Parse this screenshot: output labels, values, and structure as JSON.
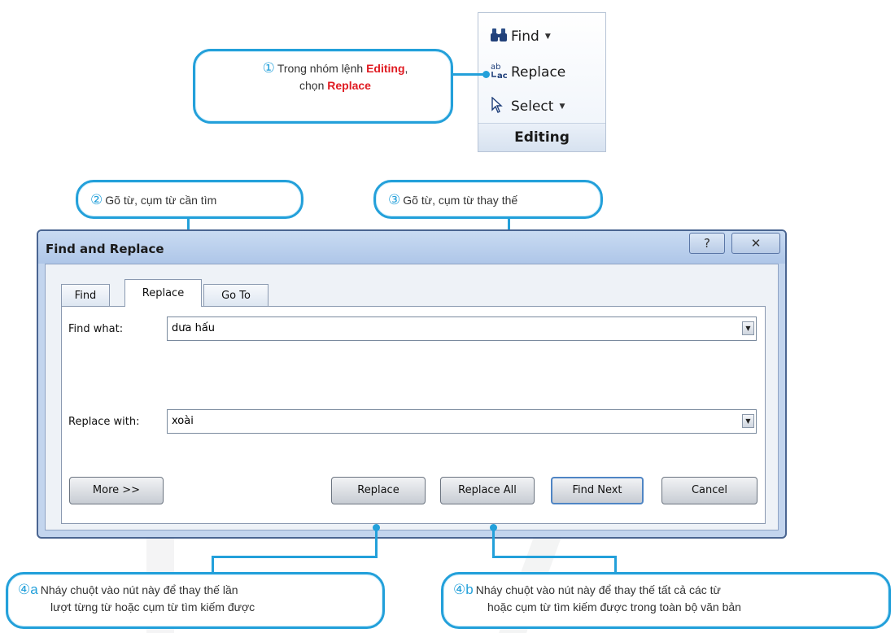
{
  "ribbon": {
    "find": "Find",
    "replace": "Replace",
    "select": "Select",
    "group": "Editing"
  },
  "callouts": {
    "c1": {
      "num": "①",
      "text_a": "Trong nhóm lệnh ",
      "text_b": "Editing",
      "text_c": ",",
      "text_d": "chọn ",
      "text_e": "Replace"
    },
    "c2": {
      "num": "②",
      "text": "Gõ từ, cụm từ cần tìm"
    },
    "c3": {
      "num": "③",
      "text": "Gõ từ, cụm từ thay thế"
    },
    "c4a": {
      "num": "④a",
      "line1": "Nháy chuột vào nút này để thay thế lần",
      "line2": "lượt từng từ hoặc cụm từ tìm kiếm được"
    },
    "c4b": {
      "num": "④b",
      "line1": "Nháy chuột vào nút này để thay thế tất cả các từ",
      "line2": "hoặc cụm từ tìm kiếm được trong toàn bộ văn bản"
    }
  },
  "dialog": {
    "title": "Find and Replace",
    "help": "?",
    "close": "✕",
    "tabs": [
      "Find",
      "Replace",
      "Go To"
    ],
    "find_label": "Find what:",
    "find_value": "dưa hấu",
    "replace_label": "Replace with:",
    "replace_value": "xoài",
    "buttons": {
      "more": "More >>",
      "replace": "Replace",
      "replace_all": "Replace All",
      "find_next": "Find Next",
      "cancel": "Cancel"
    }
  }
}
